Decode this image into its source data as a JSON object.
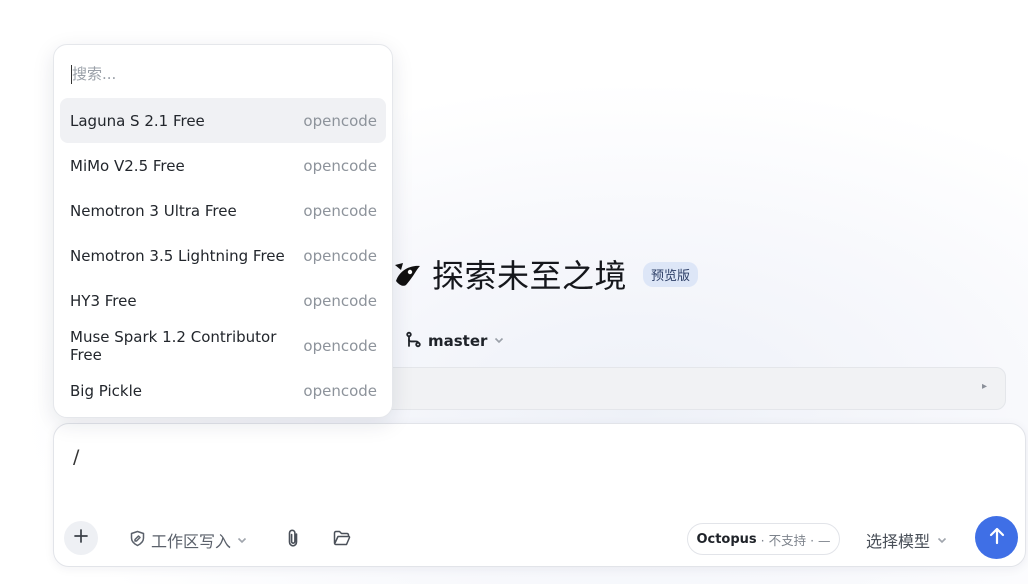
{
  "dropdown": {
    "search_placeholder": "搜索...",
    "items": [
      {
        "name": "Laguna S 2.1 Free",
        "provider": "opencode"
      },
      {
        "name": "MiMo V2.5 Free",
        "provider": "opencode"
      },
      {
        "name": "Nemotron 3 Ultra Free",
        "provider": "opencode"
      },
      {
        "name": "Nemotron 3.5 Lightning Free",
        "provider": "opencode"
      },
      {
        "name": "HY3 Free",
        "provider": "opencode"
      },
      {
        "name": "Muse Spark 1.2 Contributor Free",
        "provider": "opencode"
      },
      {
        "name": "Big Pickle",
        "provider": "opencode"
      }
    ],
    "highlighted_index": 0
  },
  "hero": {
    "title": "探索未至之境",
    "badge": "预览版"
  },
  "branch": {
    "icon": "git-branch-icon",
    "name": "master"
  },
  "path_bar": {
    "indicator": "▸"
  },
  "composer": {
    "input_value": "/",
    "mode_label": "工作区写入",
    "agent_name": "Octopus",
    "agent_meta": "· 不支持 · —",
    "model_label": "选择模型",
    "icons": {
      "add": "plus-icon",
      "mode": "shield-edit-icon",
      "attach": "paperclip-icon",
      "folder": "folder-icon",
      "send": "arrow-up-icon"
    }
  },
  "colors": {
    "accent": "#3f6fe6",
    "badge_bg": "#dde6f7",
    "highlight_bg": "#f0f1f4"
  }
}
